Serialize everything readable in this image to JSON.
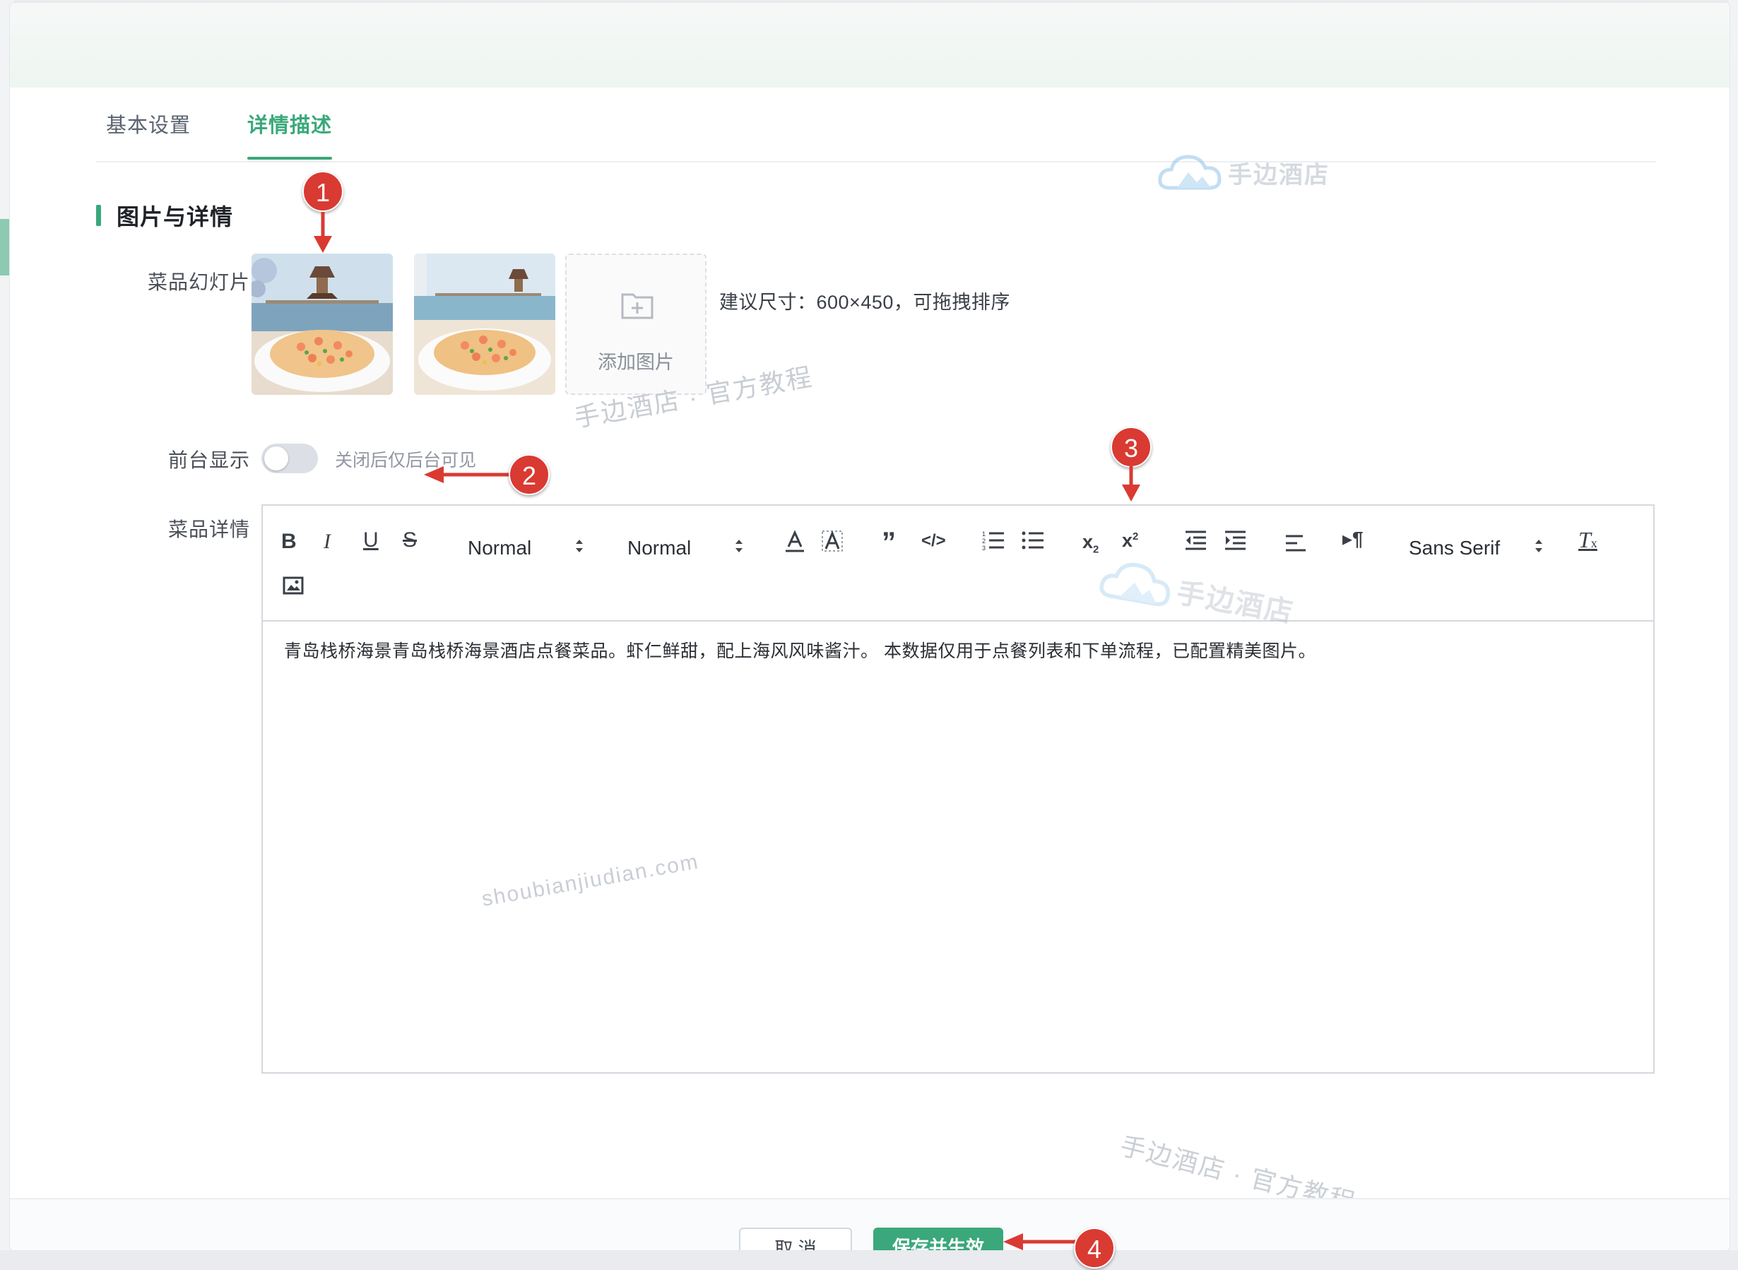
{
  "tabs": [
    {
      "label": "基本设置",
      "active": false
    },
    {
      "label": "详情描述",
      "active": true
    }
  ],
  "brand": {
    "name": "手边酒店",
    "icon": "cloud-logo-icon"
  },
  "section": {
    "title": "图片与详情"
  },
  "slides": {
    "label": "菜品幻灯片",
    "images": [
      {
        "alt": "shrimp-fried-rice-pier-photo"
      },
      {
        "alt": "shrimp-fried-rice-seaview-photo"
      }
    ],
    "add_label": "添加图片",
    "hint": "建议尺寸：600×450，可拖拽排序"
  },
  "frontend": {
    "label": "前台显示",
    "enabled": false,
    "hint": "关闭后仅后台可见"
  },
  "detail": {
    "label": "菜品详情",
    "toolbar": {
      "header_picker": "Normal",
      "size_picker": "Normal",
      "font_picker": "Sans Serif"
    },
    "content": "青岛栈桥海景青岛栈桥海景酒店点餐菜品。虾仁鲜甜，配上海风风味酱汁。 本数据仅用于点餐列表和下单流程，已配置精美图片。"
  },
  "watermarks": {
    "a": "手边酒店 · 官方教程",
    "b": "shoubianjiudian.com",
    "c": "手边酒店 · 官方教程",
    "logo_text": "手边酒店"
  },
  "footer": {
    "cancel": "取 消",
    "save": "保存并生效"
  },
  "annotations": [
    "1",
    "2",
    "3",
    "4"
  ],
  "colors": {
    "accent": "#3aa87a",
    "annotation": "#d93a32"
  }
}
